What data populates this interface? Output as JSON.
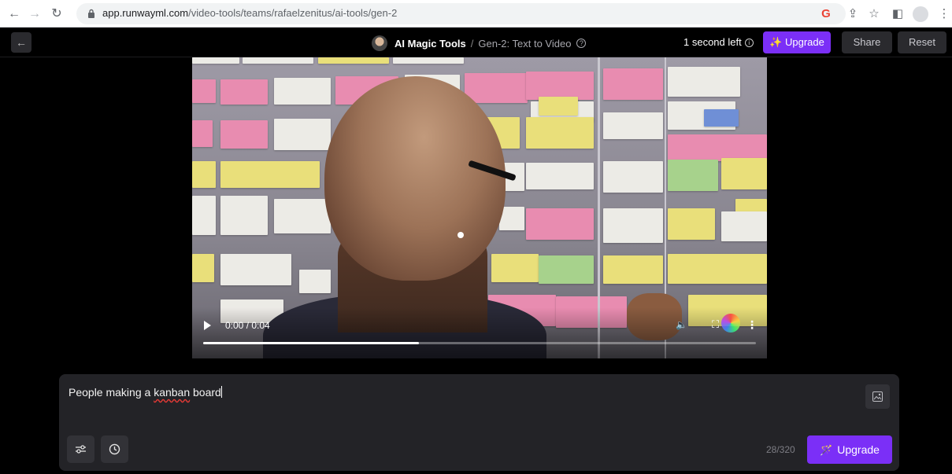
{
  "browser": {
    "url_host": "app.runwayml.com",
    "url_path": "/video-tools/teams/rafaelzenitus/ai-tools/gen-2"
  },
  "header": {
    "brand": "AI Magic Tools",
    "separator": "/",
    "tool_name": "Gen-2: Text to Video",
    "time_left": "1 second left",
    "upgrade_label": "Upgrade",
    "share_label": "Share",
    "reset_label": "Reset"
  },
  "video": {
    "current_time": "0:00 / 0:04",
    "progress_fraction": 0.39
  },
  "prompt": {
    "text_before": "People making a ",
    "text_misspelled": "kanban",
    "text_after": " board",
    "counter": "28/320",
    "upgrade_label": "Upgrade"
  },
  "colors": {
    "accent": "#7b2ff7",
    "panel": "#232327"
  }
}
